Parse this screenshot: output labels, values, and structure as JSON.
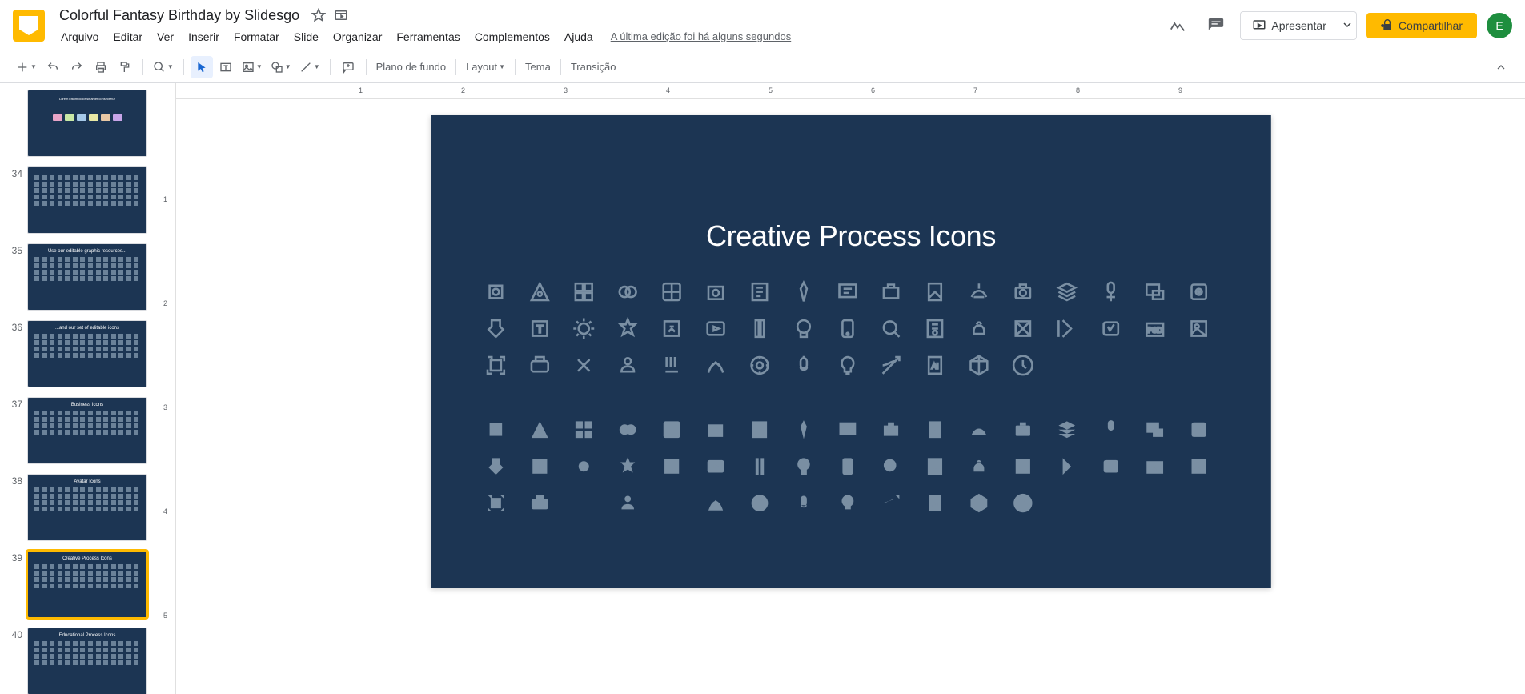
{
  "doc": {
    "title": "Colorful Fantasy Birthday by Slidesgo"
  },
  "menu": {
    "file": "Arquivo",
    "edit": "Editar",
    "view": "Ver",
    "insert": "Inserir",
    "format": "Formatar",
    "slide": "Slide",
    "arrange": "Organizar",
    "tools": "Ferramentas",
    "addons": "Complementos",
    "help": "Ajuda"
  },
  "lastEdit": "A última edição foi há alguns segundos",
  "buttons": {
    "present": "Apresentar",
    "share": "Compartilhar"
  },
  "avatar": "E",
  "toolbar": {
    "background": "Plano de fundo",
    "layout": "Layout",
    "theme": "Tema",
    "transition": "Transição"
  },
  "ruler_ticks": [
    "",
    "1",
    "2",
    "3",
    "4",
    "5",
    "6",
    "7",
    "8",
    "9"
  ],
  "thumbs": [
    {
      "n": "",
      "title": ""
    },
    {
      "n": "34",
      "title": ""
    },
    {
      "n": "35",
      "title": "Use our editable graphic resources..."
    },
    {
      "n": "36",
      "title": "...and our set of editable icons"
    },
    {
      "n": "37",
      "title": "Business Icons"
    },
    {
      "n": "38",
      "title": "Avatar Icons"
    },
    {
      "n": "39",
      "title": "Creative Process Icons",
      "selected": true
    },
    {
      "n": "40",
      "title": "Educational Process Icons"
    }
  ],
  "slide": {
    "heading": "Creative Process Icons"
  }
}
